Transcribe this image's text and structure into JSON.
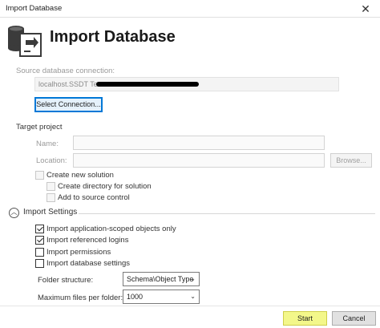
{
  "window": {
    "title": "Import Database",
    "close_glyph": "✕"
  },
  "header": {
    "title": "Import Database",
    "icon": "database-import-icon"
  },
  "source": {
    "label": "Source database connection:",
    "connection_value": "localhost.SSDT Test",
    "select_button": "Select Connection..."
  },
  "target": {
    "label": "Target project",
    "name_label": "Name:",
    "name_value": "",
    "location_label": "Location:",
    "location_value": "",
    "browse_button": "Browse...",
    "create_solution": {
      "label": "Create new solution",
      "checked": false
    },
    "create_directory": {
      "label": "Create directory for solution",
      "checked": false
    },
    "add_source_control": {
      "label": "Add to source control",
      "checked": false
    }
  },
  "import_settings": {
    "label": "Import Settings",
    "toggle_glyph": "︿",
    "options": [
      {
        "label": "Import application-scoped objects only",
        "checked": true
      },
      {
        "label": "Import referenced logins",
        "checked": true
      },
      {
        "label": "Import permissions",
        "checked": false
      },
      {
        "label": "Import database settings",
        "checked": false
      }
    ],
    "folder_structure_label": "Folder structure:",
    "folder_structure_value": "Schema\\Object Type",
    "max_files_label": "Maximum files per folder:",
    "max_files_value": "1000",
    "dropdown_glyph": "⌄"
  },
  "footer": {
    "start_button": "Start",
    "cancel_button": "Cancel"
  },
  "colors": {
    "focus": "#0078d7",
    "highlight": "#f3f78a"
  }
}
